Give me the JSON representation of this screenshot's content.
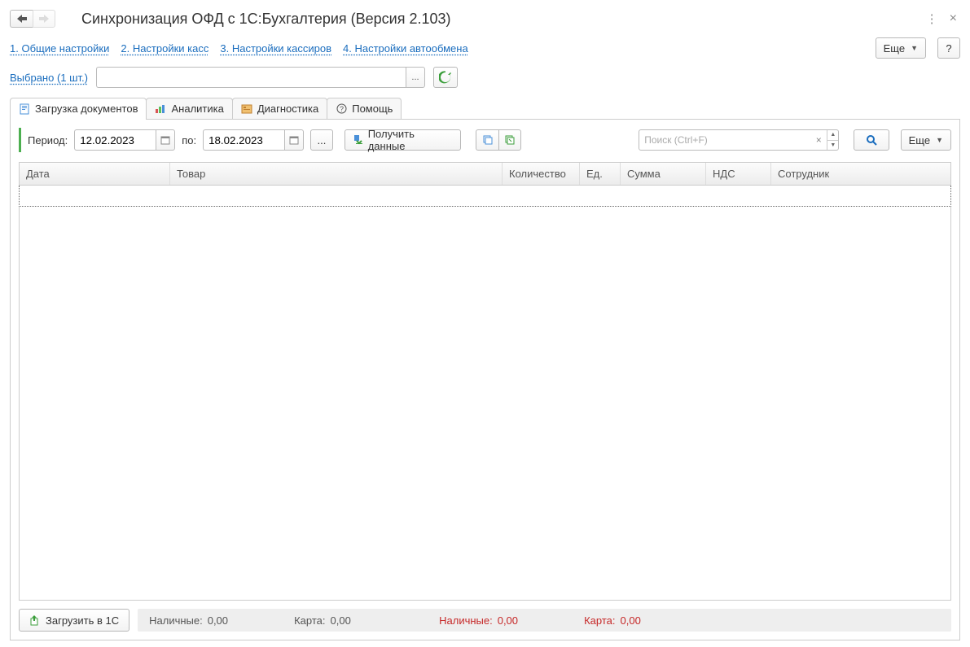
{
  "title": "Синхронизация ОФД с 1С:Бухгалтерия (Версия 2.103)",
  "links": {
    "l1": "1. Общие настройки",
    "l2": "2. Настройки касс",
    "l3": "3. Настройки кассиров",
    "l4": "4. Настройки автообмена"
  },
  "more_btn": "Еще",
  "help_btn": "?",
  "selected_link": "Выбрано (1 шт.)",
  "select_value": "",
  "tabs": {
    "load": "Загрузка документов",
    "analytics": "Аналитика",
    "diag": "Диагностика",
    "help": "Помощь"
  },
  "period": {
    "label": "Период:",
    "from": "12.02.2023",
    "to_label": "по:",
    "to": "18.02.2023"
  },
  "get_data_btn": "Получить данные",
  "search_placeholder": "Поиск (Ctrl+F)",
  "more_btn2": "Еще",
  "ellipsis": "...",
  "columns": {
    "date": "Дата",
    "product": "Товар",
    "qty": "Количество",
    "unit": "Ед.",
    "sum": "Сумма",
    "vat": "НДС",
    "emp": "Сотрудник"
  },
  "load_into_1c": "Загрузить в 1С",
  "footer": {
    "cash_label": "Наличные:",
    "cash_value": "0,00",
    "card_label": "Карта:",
    "card_value": "0,00",
    "cash2_label": "Наличные:",
    "cash2_value": "0,00",
    "card2_label": "Карта:",
    "card2_value": "0,00"
  }
}
